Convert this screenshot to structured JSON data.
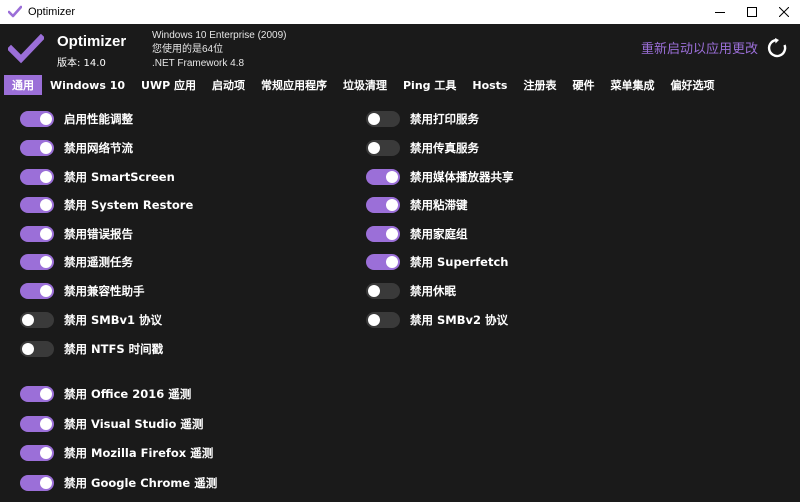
{
  "window": {
    "title": "Optimizer",
    "icon": "optimizer-check-icon"
  },
  "header": {
    "app_name": "Optimizer",
    "version": "版本: 14.0",
    "os_name": "Windows 10 Enterprise (2009)",
    "arch": "您使用的是64位",
    "framework": ".NET Framework 4.8",
    "restart_label": "重新启动以应用更改",
    "accent_color": "#9b6fd8"
  },
  "tabs": [
    {
      "label": "通用",
      "active": true
    },
    {
      "label": "Windows 10"
    },
    {
      "label": "UWP 应用"
    },
    {
      "label": "启动项"
    },
    {
      "label": "常规应用程序"
    },
    {
      "label": "垃圾清理"
    },
    {
      "label": "Ping 工具"
    },
    {
      "label": "Hosts"
    },
    {
      "label": "注册表"
    },
    {
      "label": "硬件"
    },
    {
      "label": "菜单集成"
    },
    {
      "label": "偏好选项"
    }
  ],
  "left_options": [
    {
      "label": "启用性能调整",
      "on": true
    },
    {
      "label": "禁用网络节流",
      "on": true
    },
    {
      "label": "禁用 SmartScreen",
      "on": true
    },
    {
      "label": "禁用 System Restore",
      "on": true
    },
    {
      "label": "禁用错误报告",
      "on": true
    },
    {
      "label": "禁用遥测任务",
      "on": true
    },
    {
      "label": "禁用兼容性助手",
      "on": true
    },
    {
      "label": "禁用 SMBv1 协议",
      "on": false
    },
    {
      "label": "禁用 NTFS 时间戳",
      "on": false
    },
    {
      "label": "禁用 Office 2016 遥测",
      "on": true
    },
    {
      "label": "禁用 Visual Studio 遥测",
      "on": true
    },
    {
      "label": "禁用 Mozilla Firefox 遥测",
      "on": true
    },
    {
      "label": "禁用 Google Chrome 遥测",
      "on": true
    }
  ],
  "right_options": [
    {
      "label": "禁用打印服务",
      "on": false
    },
    {
      "label": "禁用传真服务",
      "on": false
    },
    {
      "label": "禁用媒体播放器共享",
      "on": true
    },
    {
      "label": "禁用粘滞键",
      "on": true
    },
    {
      "label": "禁用家庭组",
      "on": true
    },
    {
      "label": "禁用 Superfetch",
      "on": true
    },
    {
      "label": "禁用休眠",
      "on": false
    },
    {
      "label": "禁用 SMBv2 协议",
      "on": false
    }
  ]
}
